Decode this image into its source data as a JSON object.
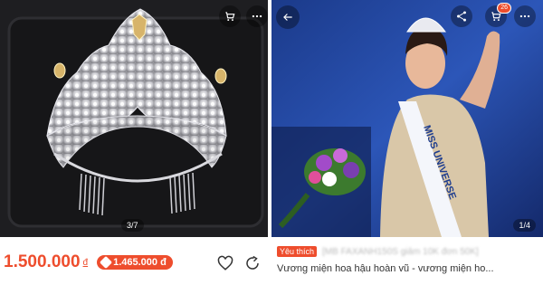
{
  "left": {
    "image_counter": "3/7",
    "price": "1.500.000",
    "currency": "đ",
    "original_price": "1.465.000 đ",
    "cart_icon": "cart-icon",
    "more_icon": "more-icon",
    "heart_icon": "heart-icon",
    "share_icon": "share-icon"
  },
  "right": {
    "image_counter": "1/4",
    "cart_badge": "26",
    "favorite_badge": "Yêu thích",
    "blurred_promo": "[MB FAXANH150S giảm 10K đơn 50K]",
    "title": "Vương miện hoa hậu hoàn vũ - vương miện ho...",
    "sash_text": "MISS UNIVERSE",
    "back_icon": "back-arrow-icon",
    "share_icon": "share-icon",
    "cart_icon": "cart-icon",
    "more_icon": "more-icon"
  },
  "colors": {
    "accent": "#ee4d2d"
  }
}
